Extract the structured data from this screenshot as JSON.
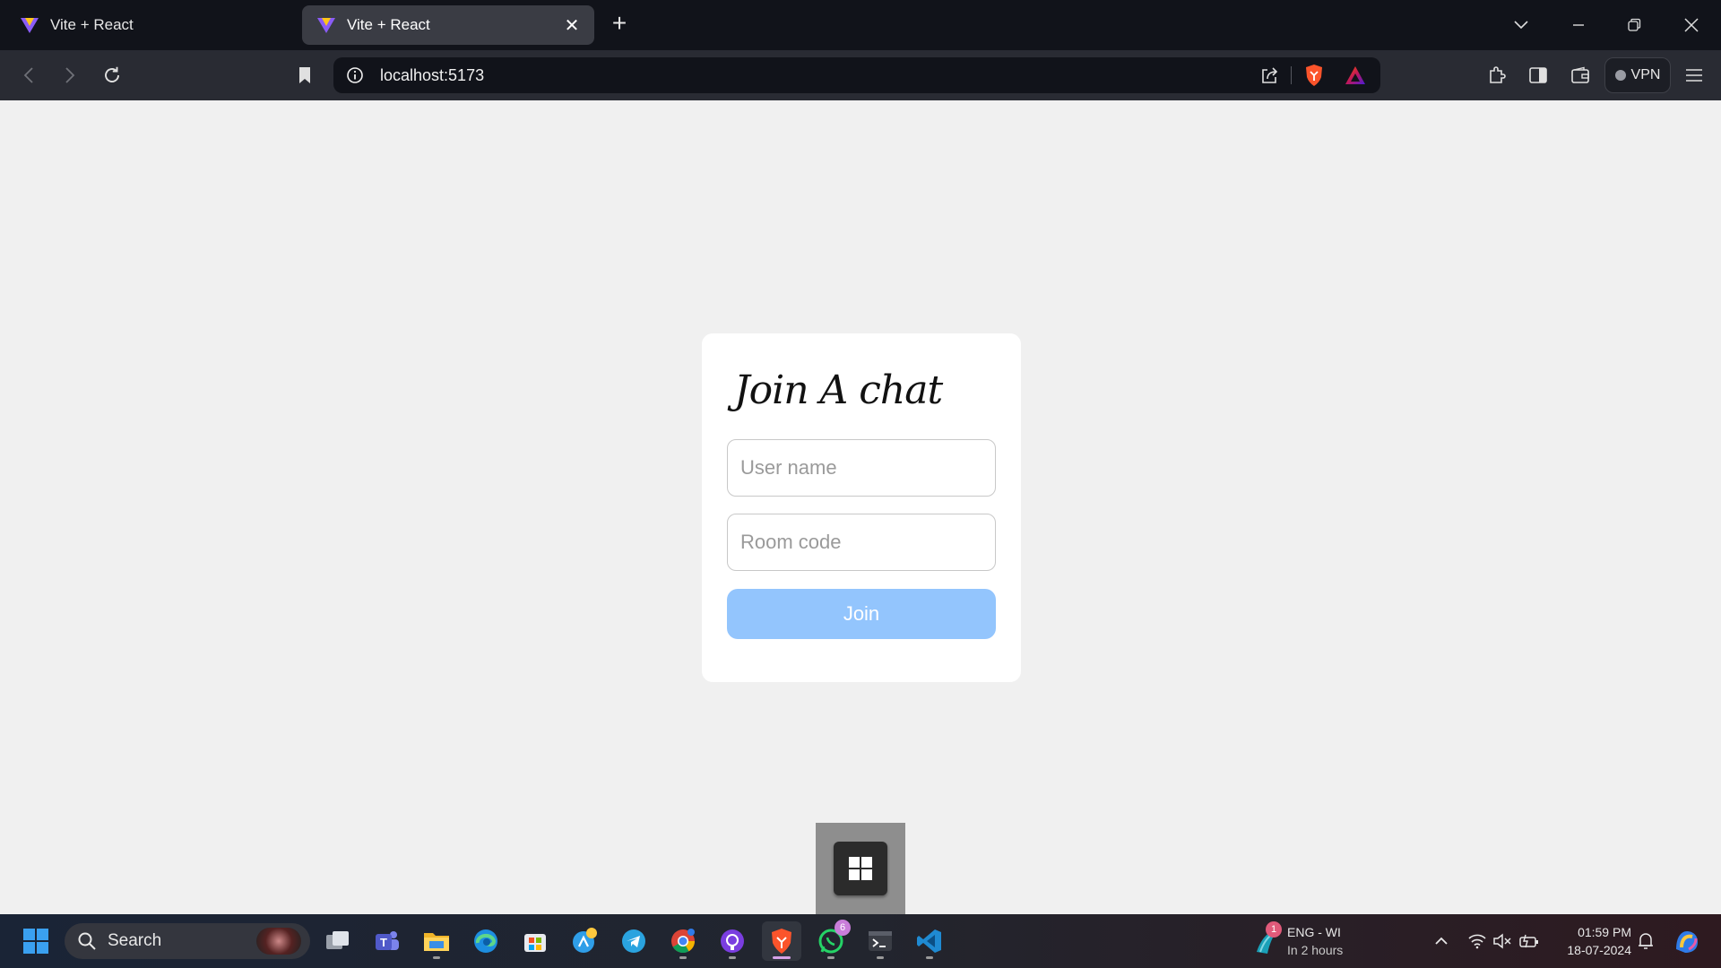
{
  "browser": {
    "tabs": [
      {
        "title": "Vite + React",
        "active": false
      },
      {
        "title": "Vite + React",
        "active": true
      }
    ],
    "url": "localhost:5173",
    "vpn_label": "VPN"
  },
  "page": {
    "heading": "Join A chat",
    "username_placeholder": "User name",
    "roomcode_placeholder": "Room code",
    "join_label": "Join",
    "join_color": "#93c5fd"
  },
  "taskbar": {
    "search_label": "Search",
    "apps": [
      "task-view",
      "teams",
      "file-explorer",
      "edge",
      "microsoft-store",
      "copilot",
      "telegram",
      "chrome",
      "github-desktop",
      "brave",
      "whatsapp",
      "terminal",
      "vscode"
    ],
    "whatsapp_badge": "6",
    "weather_badge": "1",
    "weather_line1": "ENG - WI",
    "weather_line2": "In 2 hours",
    "time": "01:59 PM",
    "date": "18-07-2024"
  }
}
